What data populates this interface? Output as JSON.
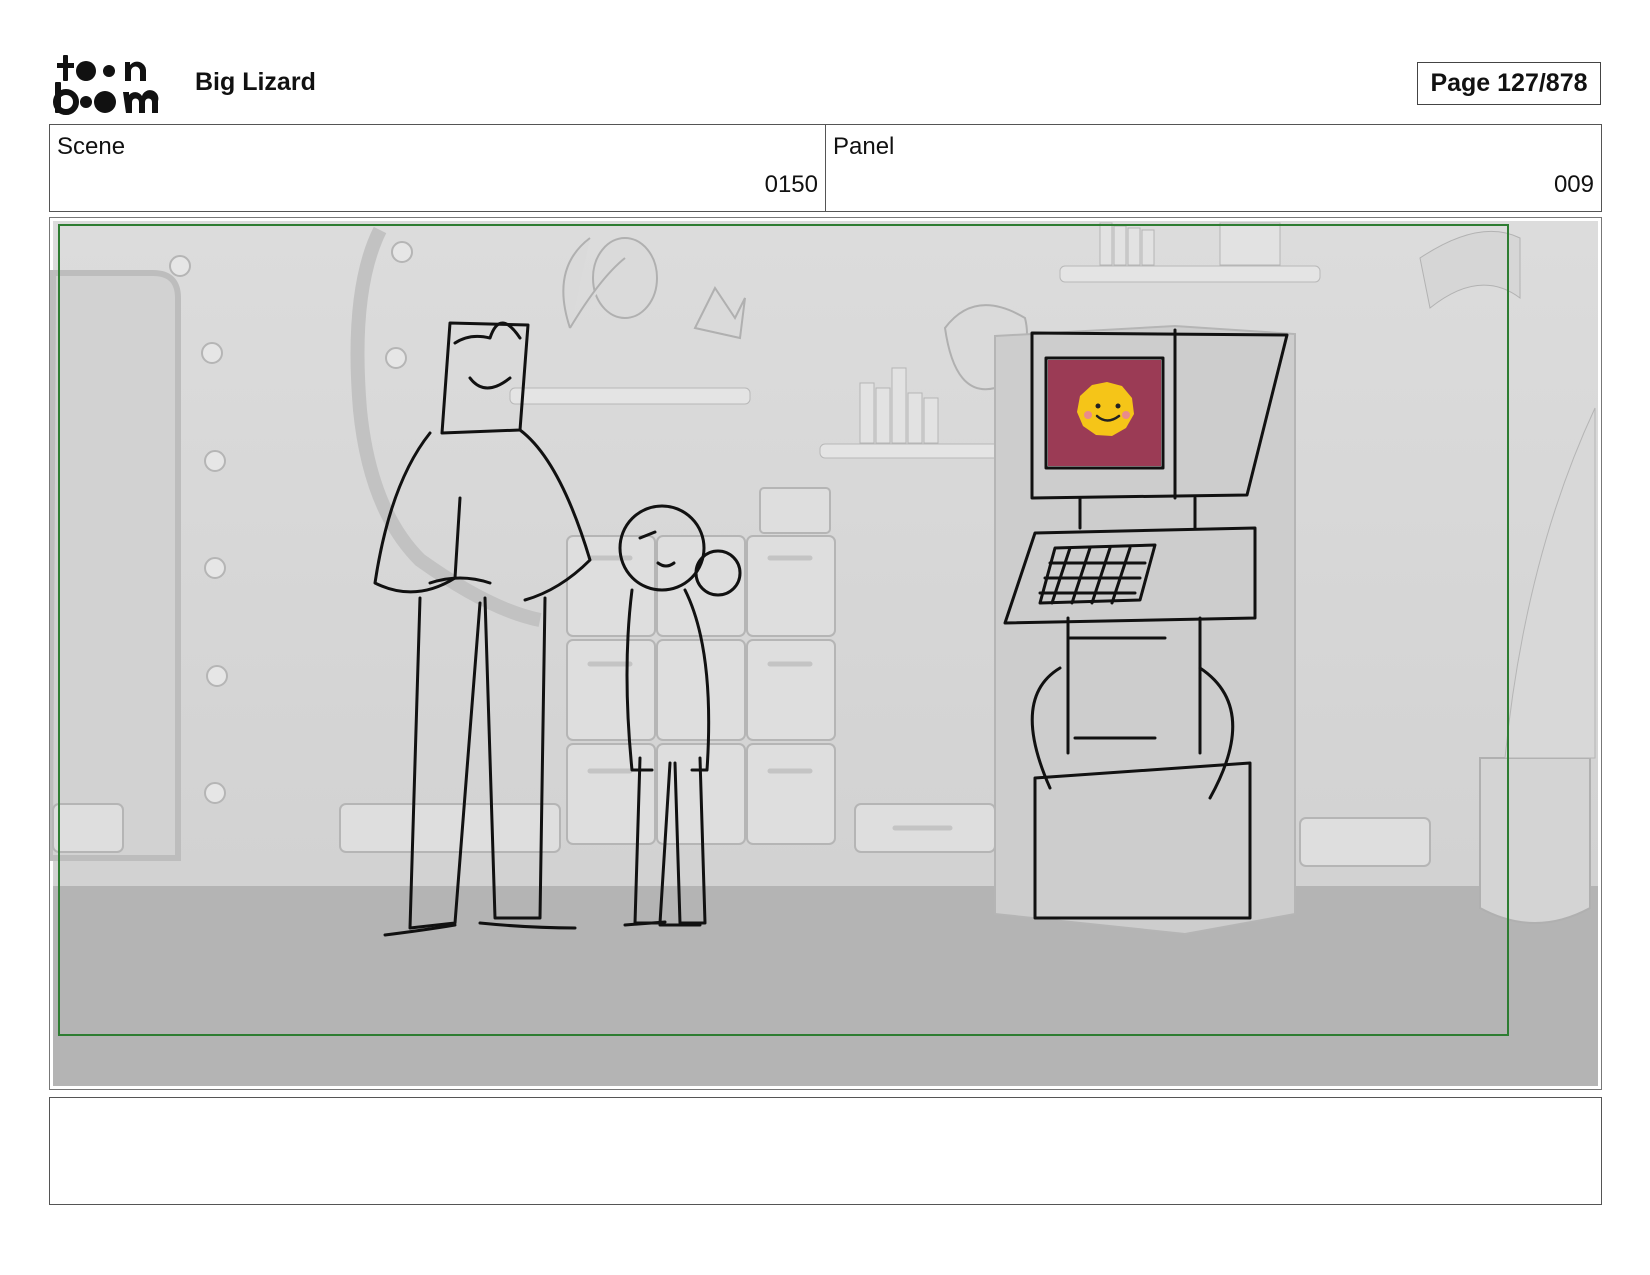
{
  "header": {
    "logo_text": "toon boom",
    "project_title": "Big Lizard",
    "page_label": "Page 127/878"
  },
  "info": {
    "scene_label": "Scene",
    "scene_value": "0150",
    "panel_label": "Panel",
    "panel_value": "009"
  },
  "panel": {
    "safe_frame_color": "#2e7d32",
    "screen_color": "#9b3b55",
    "face_color": "#f5c518"
  },
  "notes": {
    "text": ""
  }
}
